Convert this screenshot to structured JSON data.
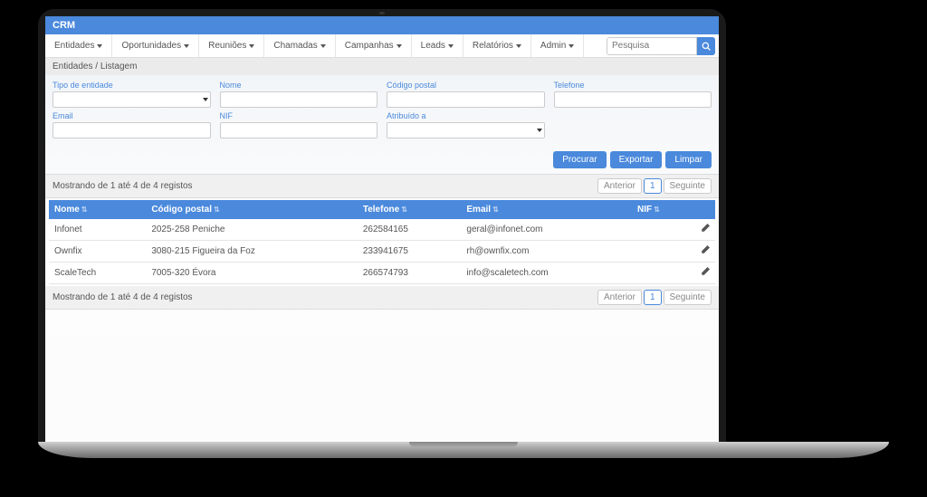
{
  "brand": "CRM",
  "nav": {
    "items": [
      "Entidades",
      "Oportunidades",
      "Reuniões",
      "Chamadas",
      "Campanhas",
      "Leads",
      "Relatórios",
      "Admin"
    ]
  },
  "search": {
    "placeholder": "Pesquisa"
  },
  "breadcrumb": {
    "root": "Entidades",
    "sep": "/",
    "current": "Listagem"
  },
  "filters": {
    "row1": [
      {
        "label": "Tipo de entidade",
        "type": "select"
      },
      {
        "label": "Nome",
        "type": "text"
      },
      {
        "label": "Código postal",
        "type": "text"
      },
      {
        "label": "Telefone",
        "type": "text"
      }
    ],
    "row2": [
      {
        "label": "Email",
        "type": "text"
      },
      {
        "label": "NIF",
        "type": "text"
      },
      {
        "label": "Atribuído a",
        "type": "select"
      },
      {
        "label": "",
        "type": "empty"
      }
    ]
  },
  "actions": {
    "search": "Procurar",
    "export": "Exportar",
    "clear": "Limpar"
  },
  "table": {
    "info": "Mostrando de 1 até 4 de 4 registos",
    "pager": {
      "prev": "Anterior",
      "page": "1",
      "next": "Seguinte"
    },
    "columns": [
      "Nome",
      "Código postal",
      "Telefone",
      "Email",
      "NIF"
    ],
    "rows": [
      {
        "nome": "Infonet",
        "cp": "2025-258 Peniche",
        "tel": "262584165",
        "email": "geral@infonet.com",
        "nif": ""
      },
      {
        "nome": "Ownfix",
        "cp": "3080-215 Figueira da Foz",
        "tel": "233941675",
        "email": "rh@ownfix.com",
        "nif": ""
      },
      {
        "nome": "ScaleTech",
        "cp": "7005-320 Évora",
        "tel": "266574793",
        "email": "info@scaletech.com",
        "nif": ""
      }
    ]
  }
}
